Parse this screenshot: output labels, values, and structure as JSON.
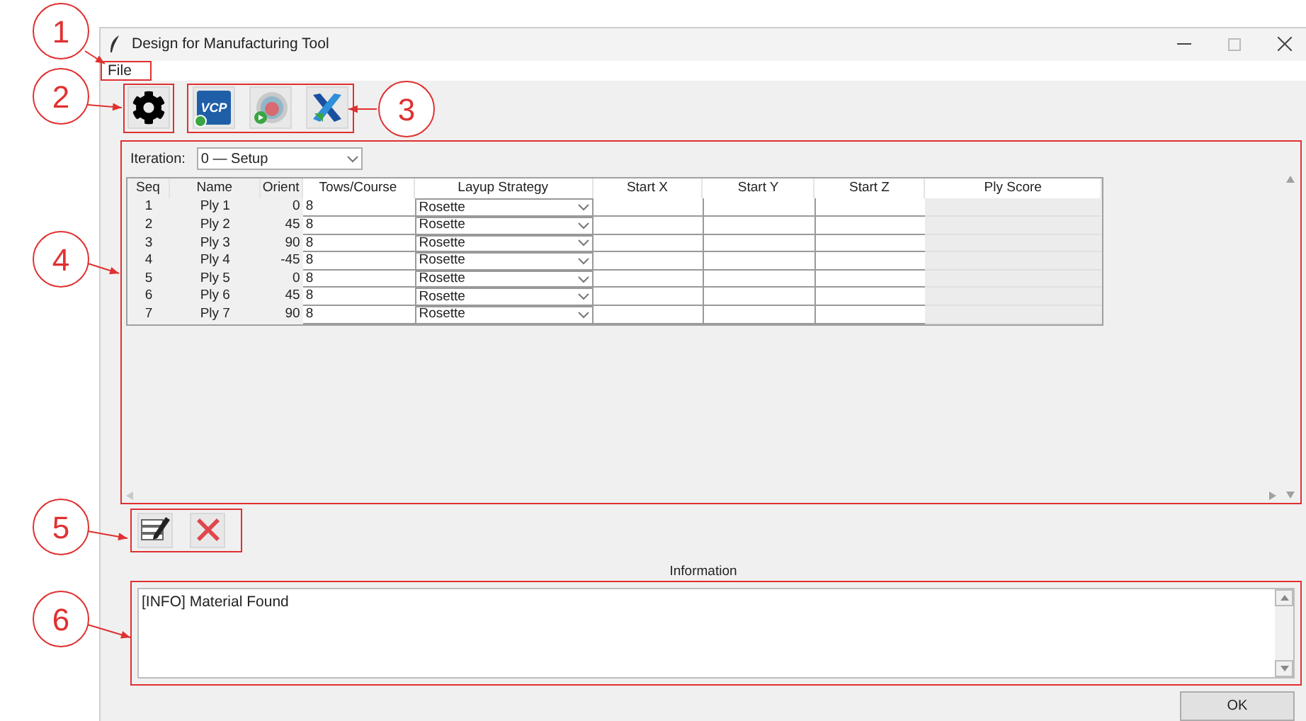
{
  "window": {
    "title": "Design for Manufacturing Tool"
  },
  "menu": [
    "File"
  ],
  "toolbar": [
    {
      "kind": "settings"
    },
    {
      "kind": "logo",
      "text": "VCP"
    },
    {
      "kind": "sphere"
    },
    {
      "kind": "cross"
    }
  ],
  "iteration": {
    "label": "Iteration:",
    "value": "0 — Setup"
  },
  "table": {
    "columns": [
      "Seq",
      "Name",
      "Orient",
      "Tows/Course",
      "Layup Strategy",
      "Start X",
      "Start Y",
      "Start Z",
      "Ply Score"
    ],
    "rows": [
      {
        "seq": "1",
        "name": "Ply 1",
        "orient": "0",
        "tows": "8",
        "strategy": "Rosette"
      },
      {
        "seq": "2",
        "name": "Ply 2",
        "orient": "45",
        "tows": "8",
        "strategy": "Rosette"
      },
      {
        "seq": "3",
        "name": "Ply 3",
        "orient": "90",
        "tows": "8",
        "strategy": "Rosette"
      },
      {
        "seq": "4",
        "name": "Ply 4",
        "orient": "-45",
        "tows": "8",
        "strategy": "Rosette"
      },
      {
        "seq": "5",
        "name": "Ply 5",
        "orient": "0",
        "tows": "8",
        "strategy": "Rosette"
      },
      {
        "seq": "6",
        "name": "Ply 6",
        "orient": "45",
        "tows": "8",
        "strategy": "Rosette"
      },
      {
        "seq": "7",
        "name": "Ply 7",
        "orient": "90",
        "tows": "8",
        "strategy": "Rosette"
      }
    ]
  },
  "actions": [
    {
      "kind": "edit"
    },
    {
      "kind": "delete"
    }
  ],
  "information": {
    "label": "Information",
    "text": "[INFO] Material Found"
  },
  "ok_button": "OK",
  "callouts": [
    "1",
    "2",
    "3",
    "4",
    "5",
    "6"
  ]
}
